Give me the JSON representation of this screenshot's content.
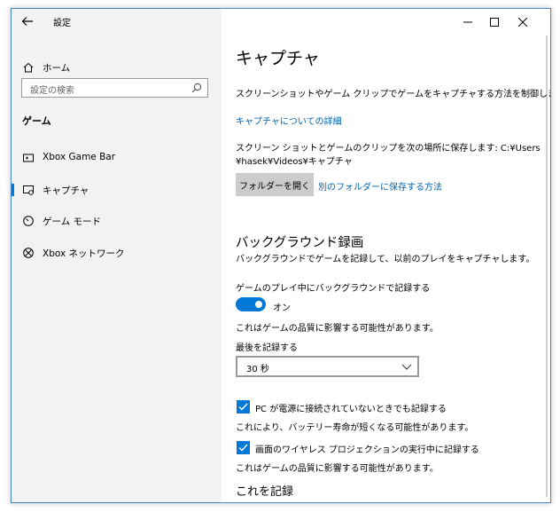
{
  "window": {
    "title": "設定"
  },
  "sidebar": {
    "home_label": "ホーム",
    "search_placeholder": "設定の検索",
    "section_title": "ゲーム",
    "items": [
      {
        "label": "Xbox Game Bar",
        "icon": "xbox-game-bar-icon"
      },
      {
        "label": "キャプチャ",
        "icon": "capture-icon"
      },
      {
        "label": "ゲーム モード",
        "icon": "game-mode-icon"
      },
      {
        "label": "Xbox ネットワーク",
        "icon": "xbox-icon"
      }
    ],
    "selected_index": 1
  },
  "main": {
    "title": "キャプチャ",
    "description": "スクリーンショットやゲーム クリップでゲームをキャプチャする方法を制御します。",
    "learn_more_link": "キャプチャについての詳細",
    "save_location_line1": "スクリーン ショットとゲームのクリップを次の場所に保存します: C:¥Users",
    "save_location_line2": "¥hasek¥Videos¥キャプチャ",
    "open_folder_button": "フォルダーを開く",
    "other_folder_link": "別のフォルダーに保存する方法",
    "background_recording": {
      "heading": "バックグラウンド録画",
      "description": "バックグラウンドでゲームを記録して、以前のプレイをキャプチャします。",
      "toggle_label": "ゲームのプレイ中にバックグラウンドで記録する",
      "toggle_state": "オン",
      "toggle_note": "これはゲームの品質に影響する可能性があります。",
      "record_last_label": "最後を記録する",
      "record_last_value": "30 秒",
      "checkbox1_label": "PC が電源に接続されていないときでも記録する",
      "checkbox1_note": "これにより、バッテリー寿命が短くなる可能性があります。",
      "checkbox2_label": "画面のワイヤレス プロジェクションの実行中に記録する",
      "checkbox2_note": "これはゲームの品質に影響する可能性があります。"
    },
    "record_this_heading": "これを記録"
  },
  "colors": {
    "accent": "#0078d7",
    "link": "#0063b1",
    "sidebar_bg": "#f2f2f2"
  }
}
